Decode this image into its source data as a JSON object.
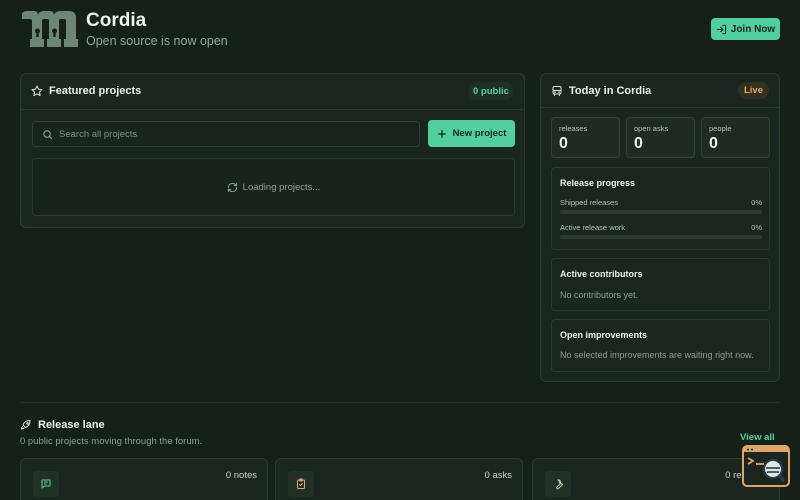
{
  "header": {
    "title": "Cordia",
    "subtitle": "Open source is now open",
    "join_label": "Join Now"
  },
  "featured": {
    "title": "Featured projects",
    "public_badge": "0 public",
    "search_placeholder": "Search all projects",
    "new_label": "New project",
    "loading_text": "Loading projects..."
  },
  "today": {
    "title": "Today in Cordia",
    "live_badge": "Live",
    "stats": [
      {
        "label": "releases",
        "value": "0"
      },
      {
        "label": "open asks",
        "value": "0"
      },
      {
        "label": "people",
        "value": "0"
      }
    ],
    "progress": {
      "title": "Release progress",
      "items": [
        {
          "label": "Shipped releases",
          "percent_text": "0%",
          "fraction": 0
        },
        {
          "label": "Active release work",
          "percent_text": "0%",
          "fraction": 0
        }
      ]
    },
    "contributors": {
      "title": "Active contributors",
      "text": "No contributors yet."
    },
    "improvements": {
      "title": "Open improvements",
      "text": "No selected improvements are waiting right now."
    }
  },
  "lane": {
    "title": "Release lane",
    "subtitle": "0 public projects moving through the forum.",
    "view_all": "View all",
    "cards": [
      {
        "count": "0 notes",
        "icon": "message-icon"
      },
      {
        "count": "0 asks",
        "icon": "clipboard-check-icon"
      },
      {
        "count": "0 releases",
        "icon": "wrench-icon"
      }
    ]
  },
  "colors": {
    "accent": "#52cf9e",
    "background": "#152019",
    "card": "#1a261f",
    "live": "#e0a566"
  }
}
